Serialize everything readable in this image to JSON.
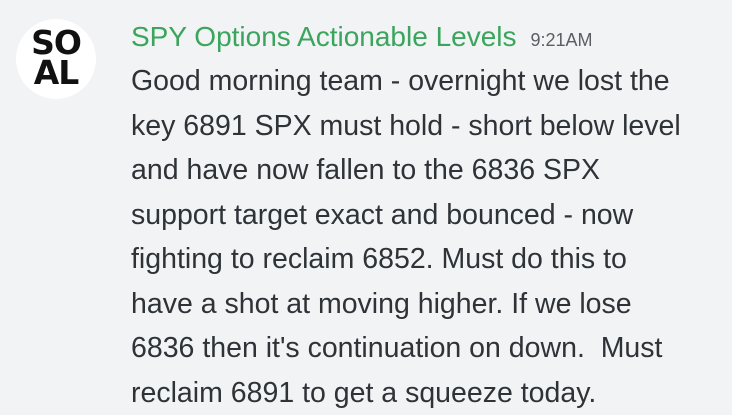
{
  "message": {
    "avatar": {
      "line1": "SO",
      "line2": "AL"
    },
    "author": "SPY Options Actionable Levels",
    "timestamp": "9:21AM",
    "lines": [
      "Good morning team - overnight we lost the",
      "key 6891 SPX must hold - short below level",
      "and have now fallen to the 6836 SPX",
      "support target exact and bounced - now",
      "fighting to reclaim 6852. Must do this to",
      "have a shot at moving higher. If we lose",
      "6836 then it's continuation on down.  Must",
      "reclaim 6891 to get a squeeze today."
    ]
  },
  "colors": {
    "background": "#f2f3f5",
    "author": "#3ba55d",
    "timestamp": "#5c5e66",
    "text": "#2e3338"
  }
}
